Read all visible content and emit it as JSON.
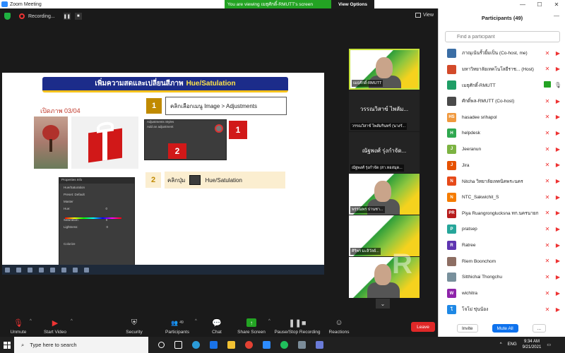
{
  "window": {
    "title": "Zoom Meeting",
    "viewing_banner": "You are viewing เมธุศักดิ์-RMUTT's screen",
    "view_options": "View Options",
    "minimize": "—",
    "maximize": "☐",
    "close": "✕"
  },
  "meeting_top": {
    "recording_label": "Recording...",
    "pause": "❚❚",
    "stop": "■",
    "view_label": "View"
  },
  "slide": {
    "title_main": "เพิ่มความสดและเปลี่ยนสีภาพ",
    "title_highlight": "Hue/Satulation",
    "open_image": "เปิดภาพ  03/04",
    "step1_num": "1",
    "step1_text": "คลิกเลือกเมนู Image > Adjustments",
    "callout1": "1",
    "callout2": "2",
    "step2_num": "2",
    "step2_text_a": "คลิกปุ่ม",
    "step2_text_b": "Hue/Satulation",
    "ps_adjust_tabs": "Adjustments    Styles",
    "ps_adjust_label": "Add an adjustment",
    "ps_props_tabs": "Properties   Info",
    "ps_props_title": "Hue/Saturation",
    "ps_preset": "Preset:   Default",
    "ps_master": "Master",
    "ps_hue": "Hue:",
    "ps_saturation": "Saturation:",
    "ps_lightness": "Lightness:",
    "ps_value_zero": "0",
    "ps_colorize": "Colorize"
  },
  "thumbnails": [
    {
      "name": "เมธุศักดิ์-RMUTT",
      "active": true
    },
    {
      "name": "วรรณวิสาข์ ไพลัม...",
      "caption": "วรรณวิสาข์ ไพลัมรินทร์ (นางรั...",
      "active": false
    },
    {
      "name": "ณัฐพงศ์ รุ่งกำจัด...",
      "caption": "ณัฐพงศ์ รุ่งกำจัด  (สา.หอสมุด...",
      "active": false
    },
    {
      "name": "พรรณพร ปานชา...",
      "active": false
    },
    {
      "name": "ศิริพร มะลิวัลย์...",
      "active": false
    },
    {
      "name": "",
      "active": false
    }
  ],
  "watermark": "R",
  "toolbar": {
    "unmute": "Unmute",
    "start_video": "Start Video",
    "security": "Security",
    "participants": "Participants",
    "participants_count": "49",
    "chat": "Chat",
    "share_screen": "Share Screen",
    "record": "Pause/Stop Recording",
    "reactions": "Reactions",
    "leave": "Leave"
  },
  "panel": {
    "title": "Participants (49)",
    "search_placeholder": "Find a participant",
    "participants": [
      {
        "initials": "",
        "name": "ภาณุเน้นรั้วยิ้มเป็น (Co-host, me)",
        "color": "#3b6ea5",
        "mic": "off",
        "video": "off"
      },
      {
        "initials": "",
        "name": "มหาวิทยาลัยเทคโนโลยีราช... (Host)",
        "color": "#d34a2a",
        "mic": "off",
        "video": "off"
      },
      {
        "initials": "",
        "name": "เมธุศักดิ์-RMUTT",
        "color": "#1f9e66",
        "mic": "on",
        "video": "on"
      },
      {
        "initials": "",
        "name": "ศักดิ์พล-RMUTT (Co-host)",
        "color": "#4a4a4a",
        "mic": "off",
        "video": "off"
      },
      {
        "initials": "HS",
        "name": "hasadee srihapol",
        "color": "#f0993e",
        "mic": "off",
        "video": "off"
      },
      {
        "initials": "H",
        "name": "helpdesk",
        "color": "#2fa84f",
        "mic": "off",
        "video": "off"
      },
      {
        "initials": "J",
        "name": "Jeeranun",
        "color": "#7cb342",
        "mic": "off",
        "video": "off"
      },
      {
        "initials": "J",
        "name": "Jira",
        "color": "#e65100",
        "mic": "off",
        "video": "off"
      },
      {
        "initials": "N",
        "name": "Nitcha  วิทยาลัยเทคนิคพระนคร",
        "color": "#e64a19",
        "mic": "off",
        "video": "off"
      },
      {
        "initials": "N",
        "name": "NTC_Sakwichit_S",
        "color": "#f57c00",
        "mic": "off",
        "video": "off"
      },
      {
        "initials": "PR",
        "name": "Piya Ruangronglucksna ทก.นครนายก",
        "color": "#b71c1c",
        "mic": "off",
        "video": "off"
      },
      {
        "initials": "P",
        "name": "pratsep",
        "color": "#26a69a",
        "mic": "off",
        "video": "off"
      },
      {
        "initials": "R",
        "name": "Ratree",
        "color": "#5e35b1",
        "mic": "off",
        "video": "off"
      },
      {
        "initials": "",
        "name": "Riem Boonchom",
        "color": "#8d6e63",
        "mic": "off",
        "video": "off"
      },
      {
        "initials": "",
        "name": "Sitthichai Thongchu",
        "color": "#78909c",
        "mic": "off",
        "video": "off"
      },
      {
        "initials": "W",
        "name": "wichitra",
        "color": "#8e24aa",
        "mic": "off",
        "video": "off"
      },
      {
        "initials": "โ",
        "name": "โจโม่ ขุ่นน้อง",
        "color": "#1e88e5",
        "mic": "off",
        "video": "off"
      }
    ],
    "invite": "Invite",
    "mute_all": "Mute All",
    "more": "..."
  },
  "taskbar": {
    "search_placeholder": "Type here to search",
    "lang": "ENG",
    "time": "9:34 AM",
    "date": "9/21/2021"
  }
}
